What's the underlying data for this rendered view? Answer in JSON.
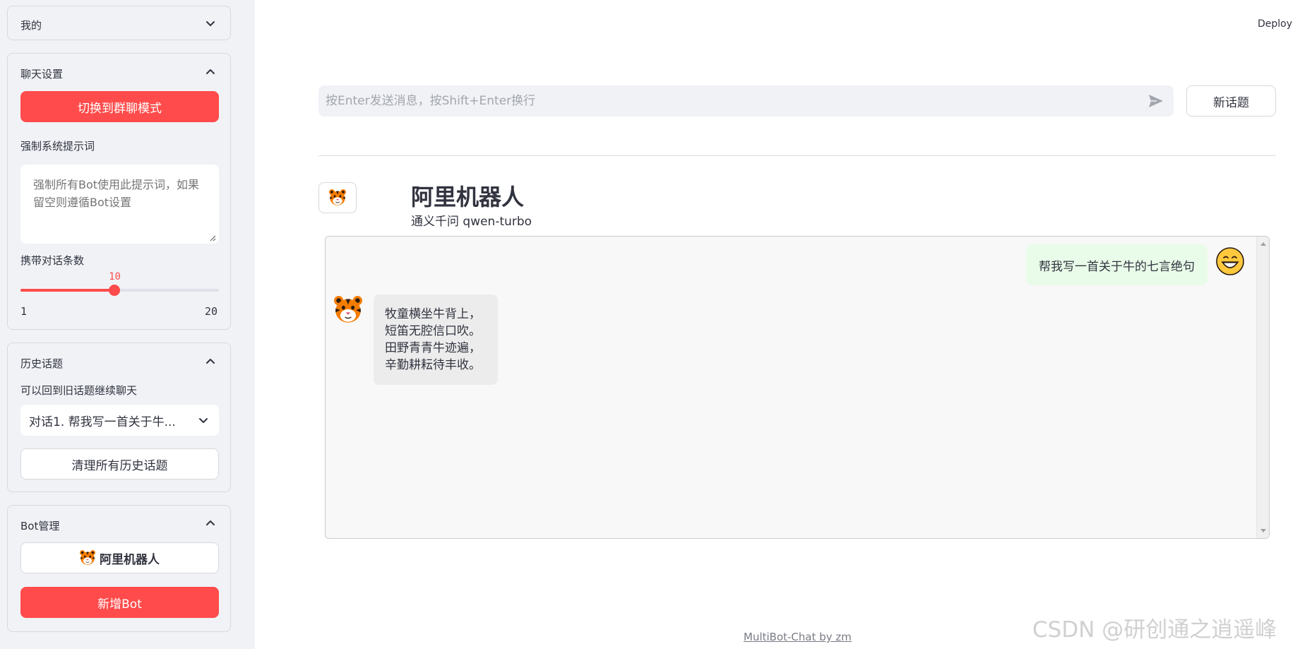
{
  "sidebar": {
    "mine": {
      "title": "我的"
    },
    "chat_settings": {
      "title": "聊天设置",
      "switch_group_button": "切换到群聊模式",
      "system_prompt_label": "强制系统提示词",
      "system_prompt_placeholder": "强制所有Bot使用此提示词，如果留空则遵循Bot设置",
      "history_count_label": "携带对话条数",
      "slider": {
        "value": 10,
        "min": 1,
        "max": 20,
        "value_text": "10",
        "min_text": "1",
        "max_text": "20"
      }
    },
    "history": {
      "title": "历史话题",
      "hint": "可以回到旧话题继续聊天",
      "selected_topic": "对话1. 帮我写一首关于牛...",
      "clear_button": "清理所有历史话题"
    },
    "bot_manage": {
      "title": "Bot管理",
      "bot_button_label": "阿里机器人",
      "add_bot_button": "新增Bot"
    }
  },
  "header": {
    "deploy": "Deploy"
  },
  "main": {
    "input_placeholder": "按Enter发送消息，按Shift+Enter换行",
    "new_topic_button": "新话题",
    "bot_name": "阿里机器人",
    "bot_model": "通义千问 qwen-turbo",
    "messages": {
      "user": "帮我写一首关于牛的七言绝句",
      "bot_lines": [
        "牧童横坐牛背上，",
        "短笛无腔信口吹。",
        "田野青青牛迹遍，",
        "辛勤耕耘待丰收。"
      ]
    }
  },
  "footer": {
    "text": "MultiBot-Chat by zm"
  },
  "watermark": {
    "text": "CSDN @研创通之逍遥峰"
  },
  "colors": {
    "primary": "#ff4b4b",
    "sidebar_bg": "#f0f2f6",
    "user_bubble": "#e9fce9",
    "bot_bubble": "#ececec"
  },
  "icons": {
    "bot_avatar": "tiger-icon",
    "user_avatar": "grinning-face-icon",
    "send": "send-icon"
  }
}
